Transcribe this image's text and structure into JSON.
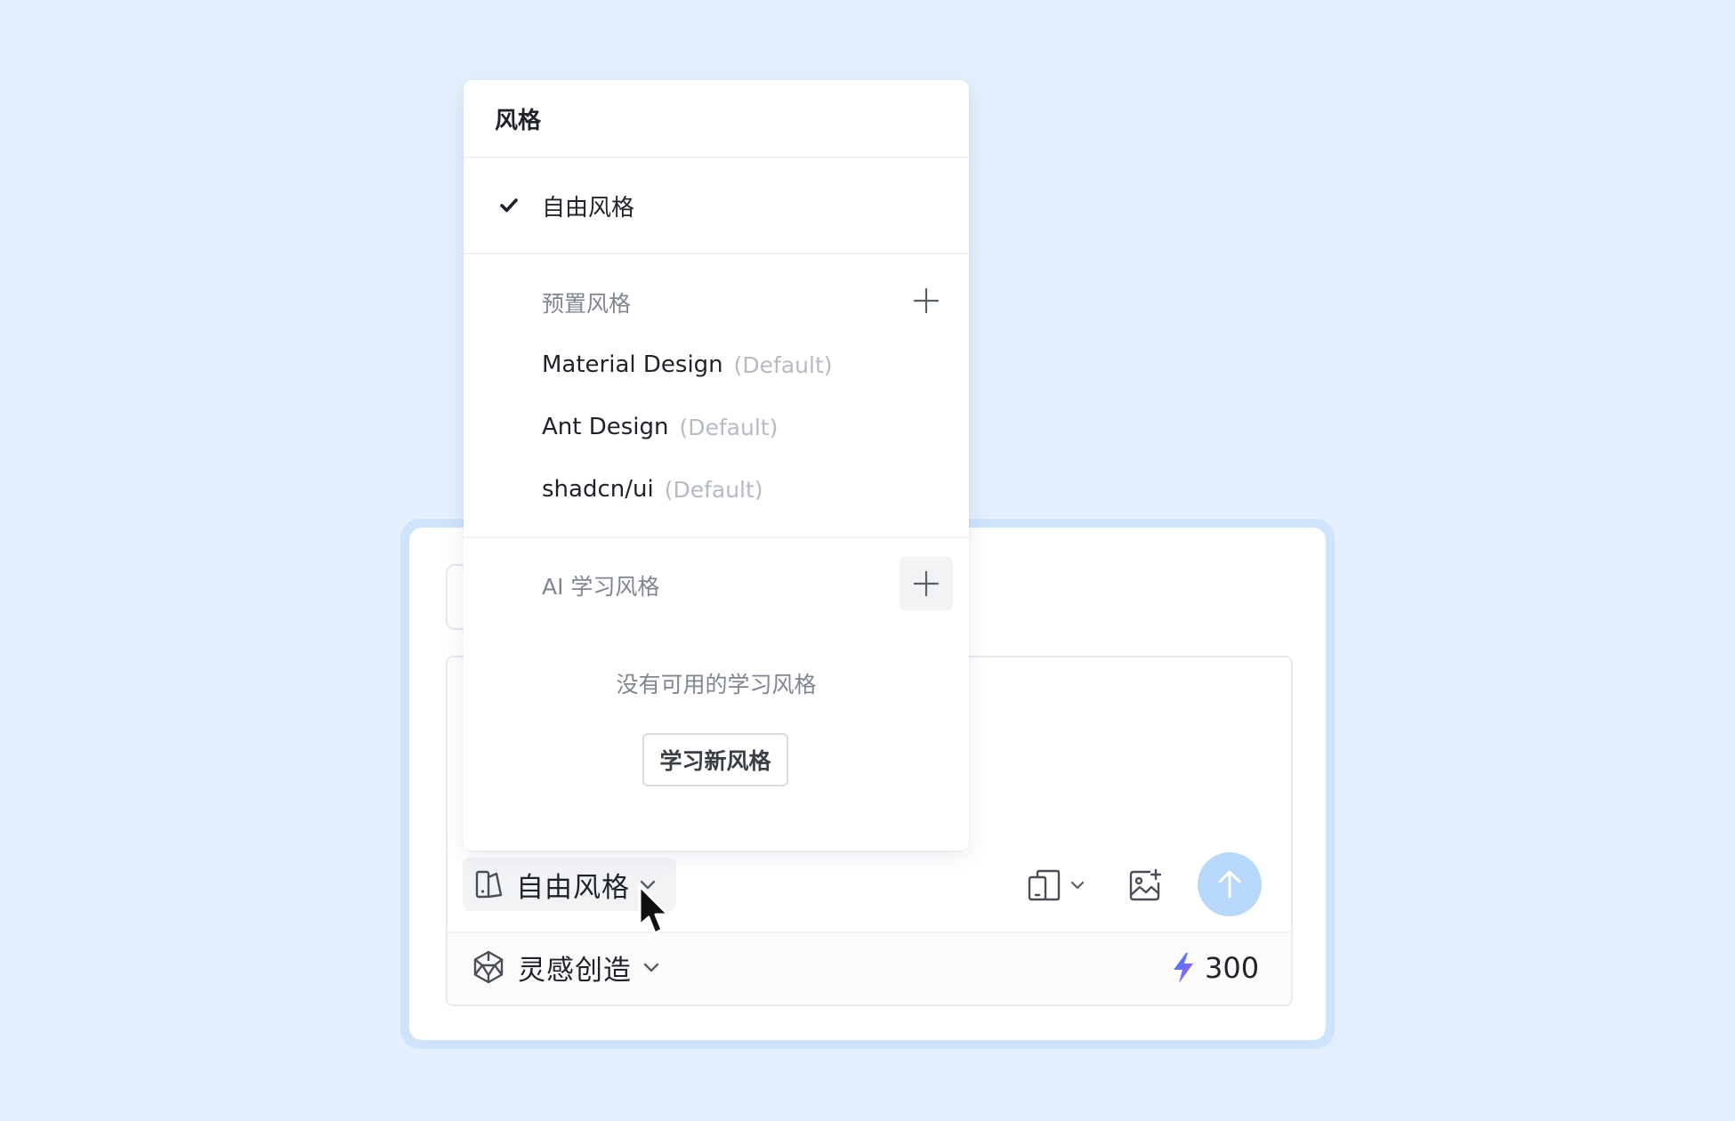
{
  "dropdown": {
    "header": "风格",
    "selected_item": "自由风格",
    "preset_section": {
      "title": "预置风格",
      "items": [
        {
          "name": "Material Design",
          "tag": "(Default)"
        },
        {
          "name": "Ant Design",
          "tag": "(Default)"
        },
        {
          "name": "shadcn/ui",
          "tag": "(Default)"
        }
      ]
    },
    "ai_section": {
      "title": "AI 学习风格",
      "empty_text": "没有可用的学习风格",
      "learn_button": "学习新风格"
    }
  },
  "composer": {
    "style_select_label": "自由风格",
    "mode_select_label": "灵感创造",
    "credits": "300"
  },
  "colors": {
    "background": "#e4f0fd",
    "send_button": "#b7d8fb",
    "bolt_gradient": [
      "#3b82f6",
      "#a855f7"
    ]
  },
  "icons": {
    "style": "style-swatch-icon",
    "mode": "polyhedron-icon",
    "device": "device-icon",
    "image": "image-add-icon",
    "send": "arrow-up-icon",
    "credits": "lightning-bolt-icon",
    "check": "check-icon",
    "add": "plus-icon"
  }
}
